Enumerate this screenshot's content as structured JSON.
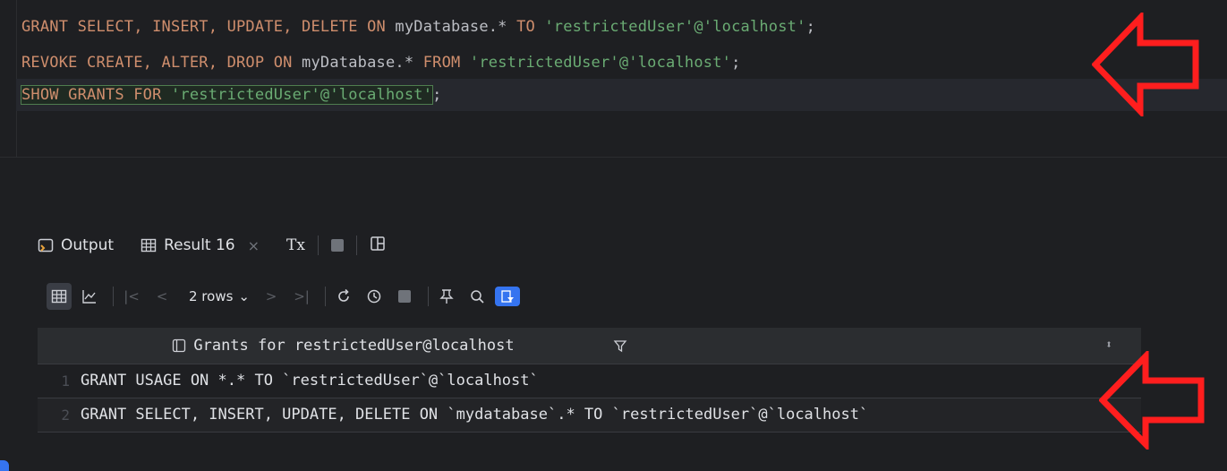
{
  "editor": {
    "lines": [
      {
        "kw1": "GRANT SELECT, INSERT, UPDATE, DELETE ON",
        "obj": " myDatabase.* ",
        "kw2": "TO",
        "sp": " ",
        "str": "'restrictedUser'@'localhost'",
        "end": ";"
      },
      {
        "kw1": "REVOKE CREATE, ALTER, DROP ON",
        "obj": " myDatabase.* ",
        "kw2": "FROM",
        "sp": " ",
        "str": "'restrictedUser'@'localhost'",
        "end": ";"
      },
      {
        "kw1": "SHOW GRANTS FOR",
        "sp": " ",
        "str": "'restrictedUser'@'localhost'",
        "end": ";"
      }
    ]
  },
  "tabs": {
    "output": "Output",
    "result": "Result 16",
    "tx": "Tx",
    "close": "×"
  },
  "toolbar": {
    "rows": "2 rows"
  },
  "grid": {
    "column": "Grants for restrictedUser@localhost",
    "rows": [
      {
        "num": "1",
        "value": "GRANT USAGE ON *.* TO `restrictedUser`@`localhost`"
      },
      {
        "num": "2",
        "value": "GRANT SELECT, INSERT, UPDATE, DELETE ON `mydatabase`.* TO `restrictedUser`@`localhost`"
      }
    ]
  },
  "colors": {
    "keyword": "#cf8e6d",
    "string": "#6aab73",
    "arrow": "#ff1e1e"
  }
}
